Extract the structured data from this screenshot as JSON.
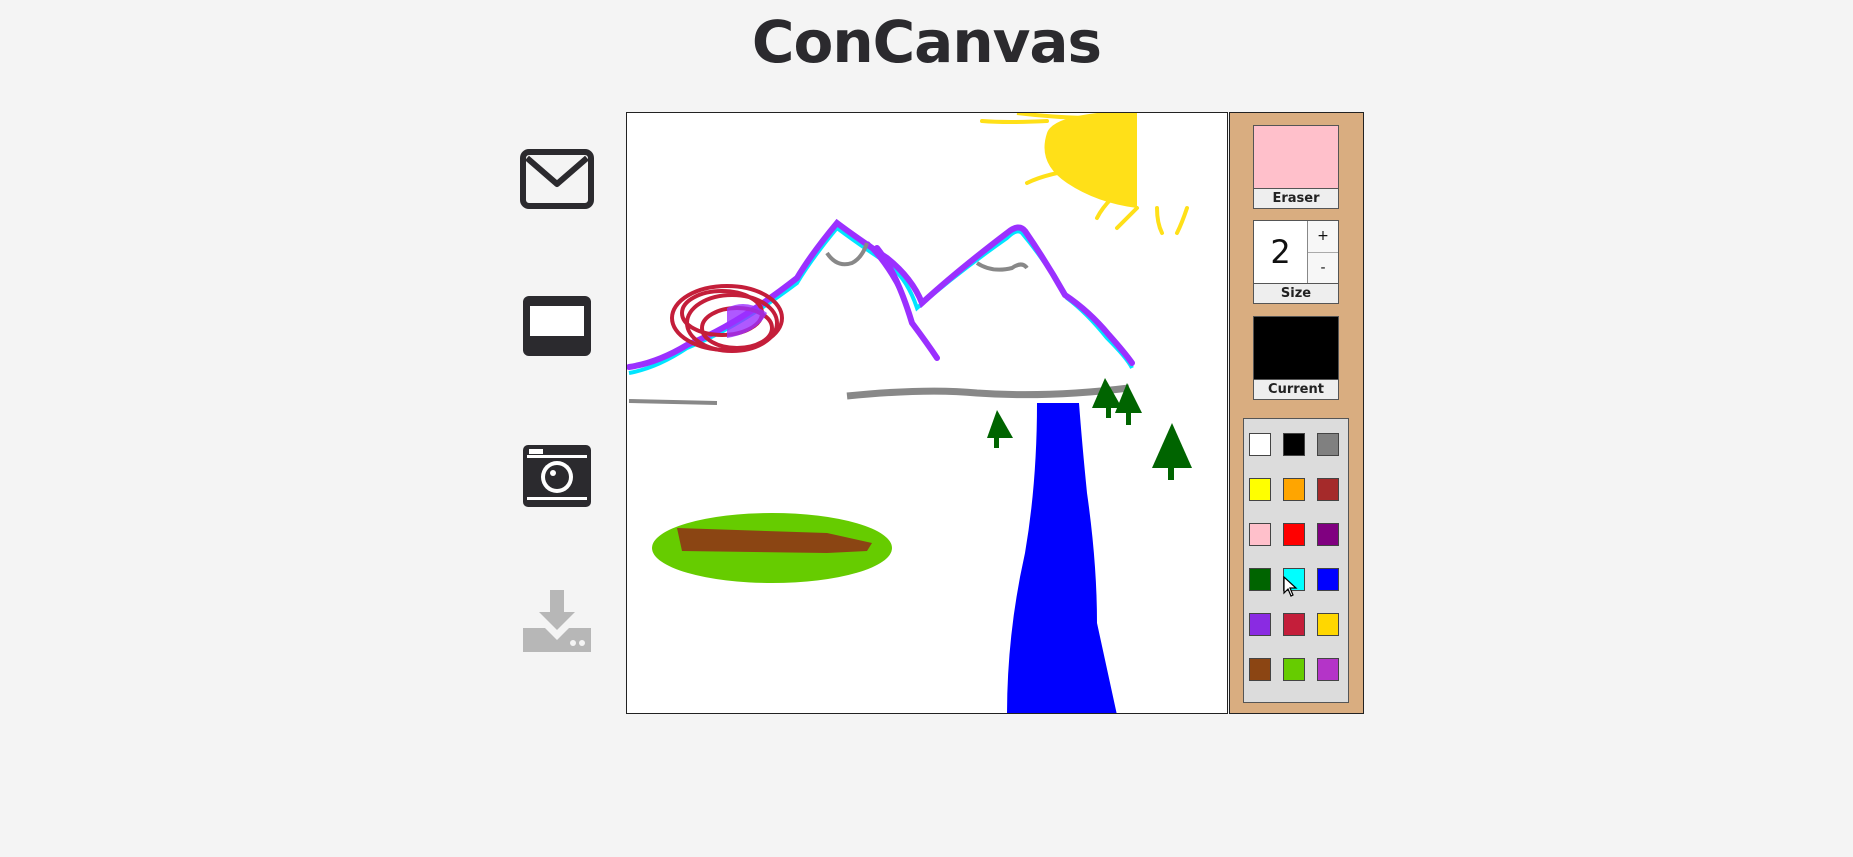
{
  "app": {
    "title": "ConCanvas"
  },
  "sidebar": {
    "items": [
      {
        "name": "mail-icon"
      },
      {
        "name": "window-icon"
      },
      {
        "name": "camera-icon"
      },
      {
        "name": "download-icon"
      }
    ]
  },
  "tools": {
    "eraser_label": "Eraser",
    "size_value": "2",
    "size_plus": "+",
    "size_minus": "-",
    "size_label": "Size",
    "current_label": "Current",
    "eraser_color": "#ffc0cb",
    "current_color": "#000000"
  },
  "palette": [
    [
      "#ffffff",
      "#000000",
      "#808080"
    ],
    [
      "#ffff00",
      "#ffa500",
      "#a52a2a"
    ],
    [
      "#ffc0cb",
      "#ff0000",
      "#800080"
    ],
    [
      "#006400",
      "#00ffff",
      "#0000ff"
    ],
    [
      "#8a2be2",
      "#c41e3a",
      "#ffd700"
    ],
    [
      "#8b4513",
      "#66cc00",
      "#b434c8"
    ]
  ]
}
